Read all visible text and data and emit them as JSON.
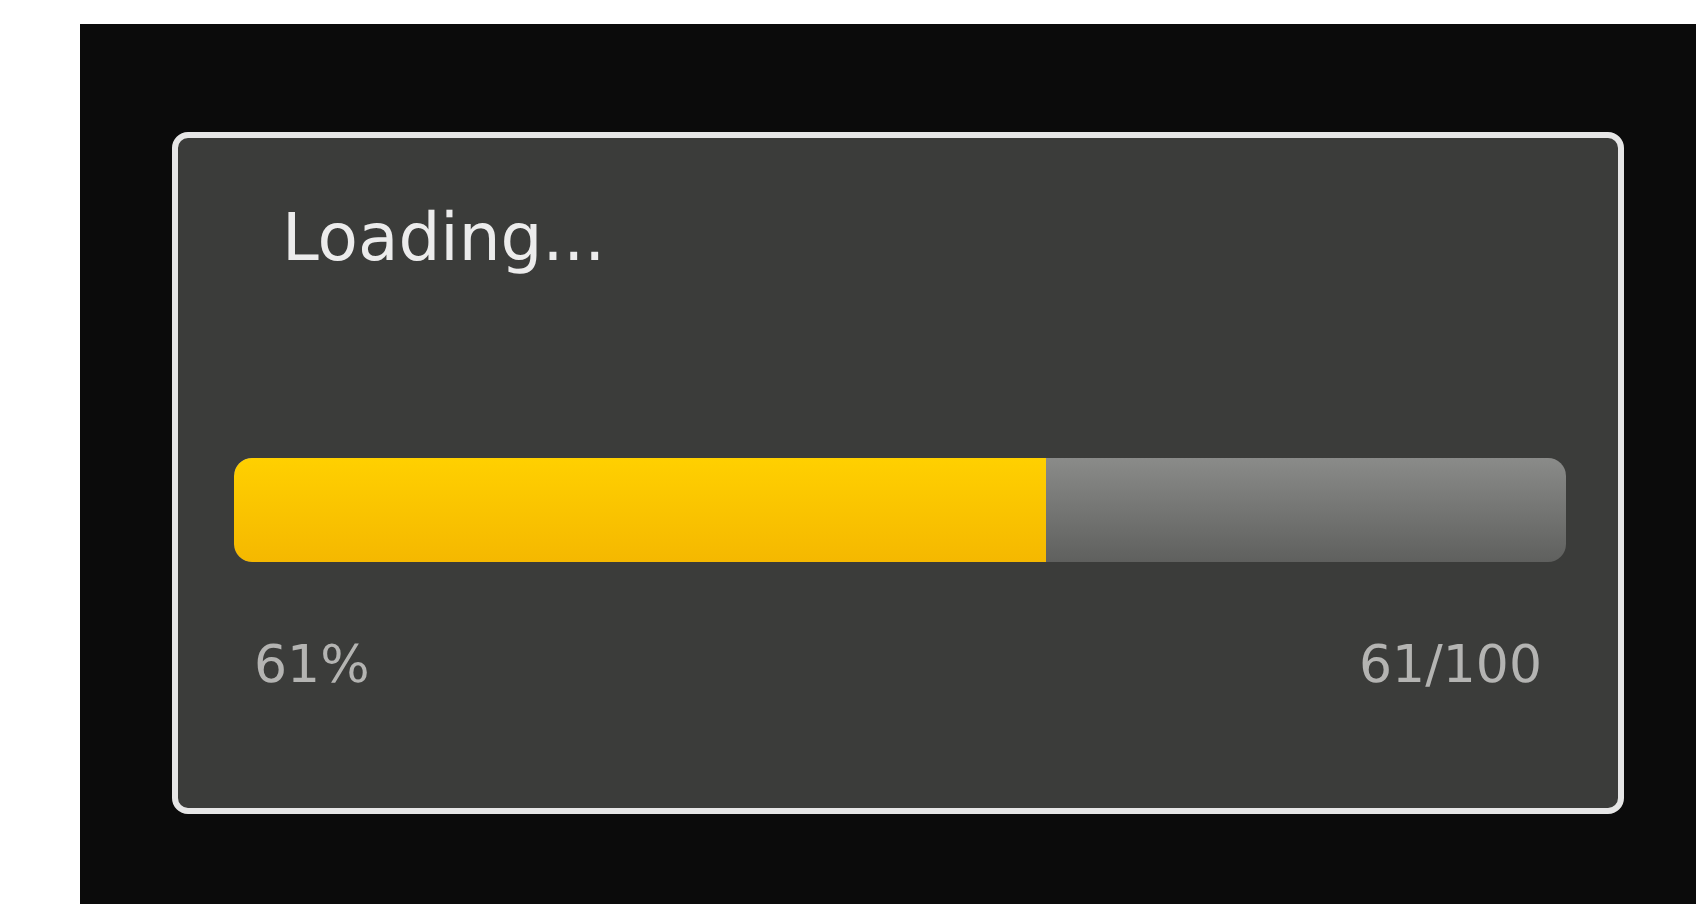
{
  "dialog": {
    "title": "Loading...",
    "progress": {
      "level": 0.61,
      "percent": "61%",
      "count": "61/100"
    }
  }
}
